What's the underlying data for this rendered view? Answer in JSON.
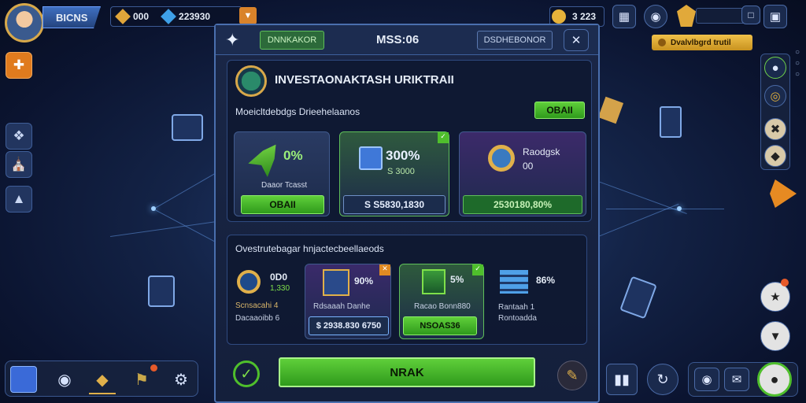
{
  "player": {
    "name": "BICNS"
  },
  "resources": {
    "gold": "000",
    "gems": "223930",
    "coins": "3 223"
  },
  "top_right": {
    "quest_text": "Dvalvlbgrd trutil"
  },
  "modal": {
    "tab_left": "DNNKAKOR",
    "title": "MSS:06",
    "tab_right": "DSDHEBONOR",
    "section1": {
      "heading": "INVESTAONAKTASH URIKTRAII",
      "subheading": "Moeicltdebdgs Drieehelaanos",
      "header_button": "OBAII",
      "cards": [
        {
          "value": "0%",
          "label": "Daaor Tcasst",
          "button": "OBAII",
          "style": "green"
        },
        {
          "value": "300%",
          "label": "S 3000",
          "button": "S S5830,1830",
          "style": "dark"
        },
        {
          "value": "Raodgsk",
          "label": "00",
          "button": "2530180,80%",
          "style": "greendark"
        }
      ]
    },
    "section2": {
      "heading": "Ovestrutebagar hnjactecbeellaeods",
      "cards": [
        {
          "value": "0D0",
          "sub": "1,330",
          "label1": "Scnsacahi 4",
          "label2": "Dacaaoibb 6",
          "button": ""
        },
        {
          "value": "90%",
          "label1": "Rdsaaah Danhe",
          "button": "$ 2938.830 6750"
        },
        {
          "value": "5%",
          "label1": "Racao Bonn880",
          "button": "NSOAS36"
        },
        {
          "value": "86%",
          "label1": "Rantaah 1",
          "label2": "Rontoadda"
        }
      ]
    },
    "main_button": "NRAK"
  },
  "colors": {
    "accent_green": "#4fbf2c",
    "frame_blue": "#4a6fae",
    "gold": "#e0b04a"
  }
}
